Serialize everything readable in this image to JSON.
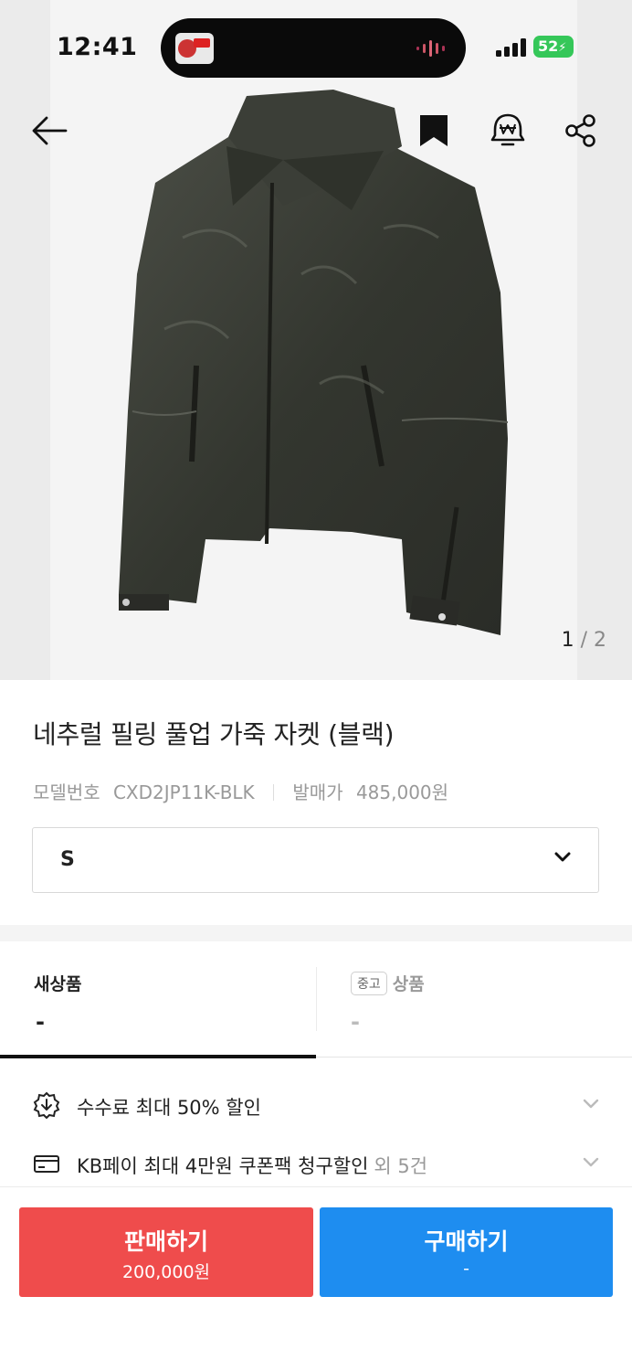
{
  "status_bar": {
    "time": "12:41",
    "battery": "52"
  },
  "product": {
    "page_indicator": {
      "current": "1",
      "separator": "/",
      "total": "2"
    },
    "title": "네추럴 필링 풀업 가죽 자켓 (블랙)",
    "model_label": "모델번호",
    "model_value": "CXD2JP11K-BLK",
    "release_price_label": "발매가",
    "release_price_value": "485,000원"
  },
  "size_select": {
    "value": "S"
  },
  "tabs": {
    "new": {
      "label": "새상품",
      "value": "-"
    },
    "used": {
      "badge": "중고",
      "label": "상품",
      "value": "-"
    }
  },
  "benefits": [
    {
      "text": "수수료 최대 50% 할인",
      "extra": ""
    },
    {
      "text": "KB페이 최대 4만원 쿠폰팩 청구할인",
      "extra": "외 5건"
    }
  ],
  "actions": {
    "sell": {
      "label": "판매하기",
      "price": "200,000원"
    },
    "buy": {
      "label": "구매하기",
      "price": "-"
    }
  },
  "colors": {
    "sell": "#ef4c4c",
    "buy": "#1e8df0",
    "battery": "#35c759"
  }
}
